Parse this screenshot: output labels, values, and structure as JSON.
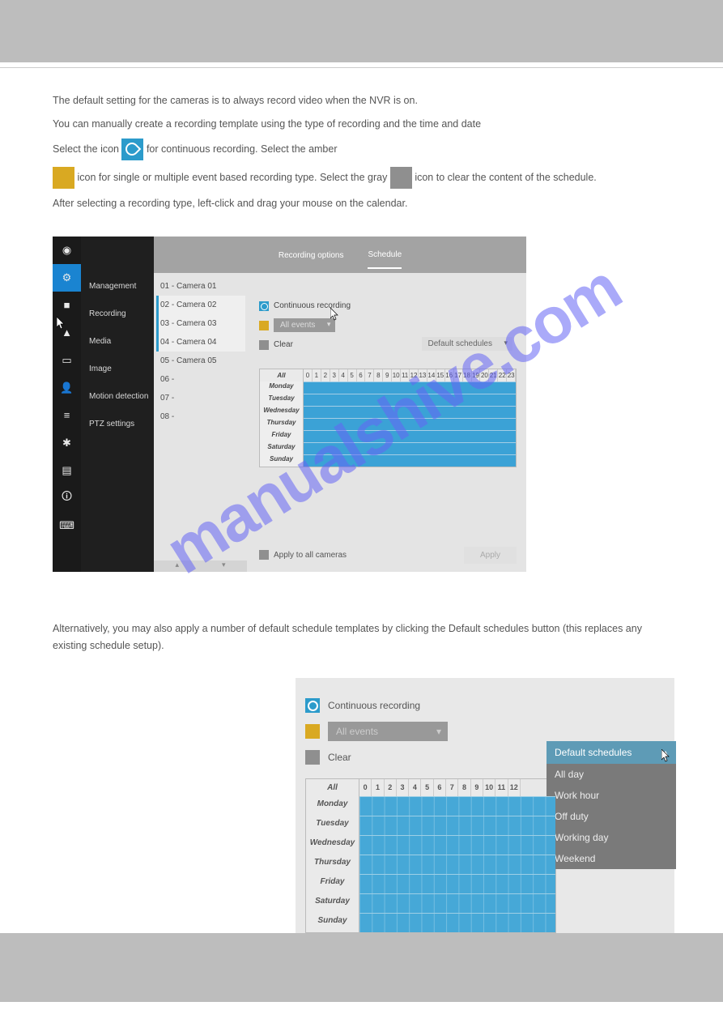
{
  "page": {
    "intro_text": "The default setting for the cameras is to always record video when the NVR is on.",
    "date_time_text": "You can manually create a recording template using the type of recording and the time and date",
    "select_text_1": "Select the icon ",
    "select_text_2": " for continuous recording. Select the amber",
    "swatch_text_1": " icon for single or multiple event based recording type.",
    "select_gray": "Select the gray ",
    "swatch_gray_text": " icon to clear the content of the schedule.",
    "final_text": "After selecting a recording type, left-click and drag your mouse on the calendar.",
    "default_text": "Alternatively, you may also apply a number of default schedule templates by clicking the Default schedules button (this replaces any existing schedule setup)."
  },
  "screenshot1": {
    "header": {
      "tab1": "Recording options",
      "tab2": "Schedule"
    },
    "sidebar_items": [
      "",
      "Management",
      "Recording",
      "Media",
      "Image",
      "Motion detection",
      "PTZ settings"
    ],
    "cameras": [
      "01 - Camera 01",
      "02 - Camera 02",
      "03 - Camera 03",
      "04 - Camera 04",
      "05 - Camera 05",
      "06 -",
      "07 -",
      "08 -"
    ],
    "legend": {
      "continuous": "Continuous recording",
      "events": "All events",
      "clear": "Clear"
    },
    "default_schedules": "Default schedules",
    "days": [
      "Monday",
      "Tuesday",
      "Wednesday",
      "Thursday",
      "Friday",
      "Saturday",
      "Sunday"
    ],
    "all_label": "All",
    "hours": [
      "0",
      "1",
      "2",
      "3",
      "4",
      "5",
      "6",
      "7",
      "8",
      "9",
      "10",
      "11",
      "12",
      "13",
      "14",
      "15",
      "16",
      "17",
      "18",
      "19",
      "20",
      "21",
      "22",
      "23"
    ],
    "apply_all": "Apply to all cameras",
    "apply_btn": "Apply"
  },
  "screenshot2": {
    "legend": {
      "continuous": "Continuous recording",
      "events": "All events",
      "clear": "Clear"
    },
    "default_schedules": "Default schedules",
    "menu_items": [
      "All day",
      "Work hour",
      "Off duty",
      "Working day",
      "Weekend"
    ],
    "days": [
      "Monday",
      "Tuesday",
      "Wednesday",
      "Thursday",
      "Friday",
      "Saturday",
      "Sunday"
    ],
    "all_label": "All",
    "hours": [
      "0",
      "1",
      "2",
      "3",
      "4",
      "5",
      "6",
      "7",
      "8",
      "9",
      "10",
      "11",
      "12"
    ]
  },
  "watermark": "manualshive.com"
}
